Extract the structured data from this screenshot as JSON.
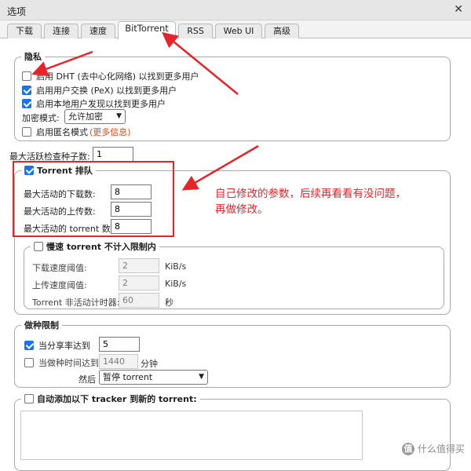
{
  "window": {
    "title": "选项"
  },
  "tabs": [
    "下载",
    "连接",
    "速度",
    "BitTorrent",
    "RSS",
    "Web UI",
    "高级"
  ],
  "privacy": {
    "legend": "隐私",
    "dht_label": "启用 DHT (去中心化网络) 以找到更多用户",
    "dht_checked": false,
    "pex_label": "启用用户交换 (PeX) 以找到更多用户",
    "pex_checked": true,
    "lsd_label": "启用本地用户发现以找到更多用户",
    "lsd_checked": true,
    "encryption_label": "加密模式:",
    "encryption_value": "允许加密",
    "anon_label": "启用匿名模式",
    "anon_more": "(更多信息)",
    "anon_checked": false
  },
  "max_checking": {
    "label": "最大活跃检查种子数:",
    "value": "1"
  },
  "queue": {
    "legend": "Torrent 排队",
    "checked": true,
    "downloads_label": "最大活动的下载数:",
    "downloads_value": "8",
    "uploads_label": "最大活动的上传数:",
    "uploads_value": "8",
    "torrents_label": "最大活动的 torrent 数:",
    "torrents_value": "8",
    "slow": {
      "legend": "慢速 torrent 不计入限制内",
      "checked": false,
      "dl_label": "下载速度阈值:",
      "dl_value": "2",
      "dl_unit": "KiB/s",
      "ul_label": "上传速度阈值:",
      "ul_value": "2",
      "ul_unit": "KiB/s",
      "timer_label": "Torrent 非活动计时器:",
      "timer_value": "60",
      "timer_unit": "秒"
    }
  },
  "seeding": {
    "legend": "做种限制",
    "ratio_label": "当分享率达到",
    "ratio_checked": true,
    "ratio_value": "5",
    "time_label": "当做种时间达到",
    "time_checked": false,
    "time_value": "1440",
    "time_unit": "分钟",
    "then_label": "然后",
    "action_value": "暂停 torrent"
  },
  "trackers": {
    "legend": "自动添加以下 tracker 到新的 torrent:",
    "checked": false
  },
  "annotation": {
    "line1": "自己修改的参数，后续再看看有没问题，",
    "line2": "再做修改。"
  },
  "watermark": {
    "badge": "值",
    "text": "什么值得买"
  },
  "colors": {
    "annotation": "#e5252a",
    "checkbox_on": "#1a73e8",
    "link": "#e04b1c"
  }
}
